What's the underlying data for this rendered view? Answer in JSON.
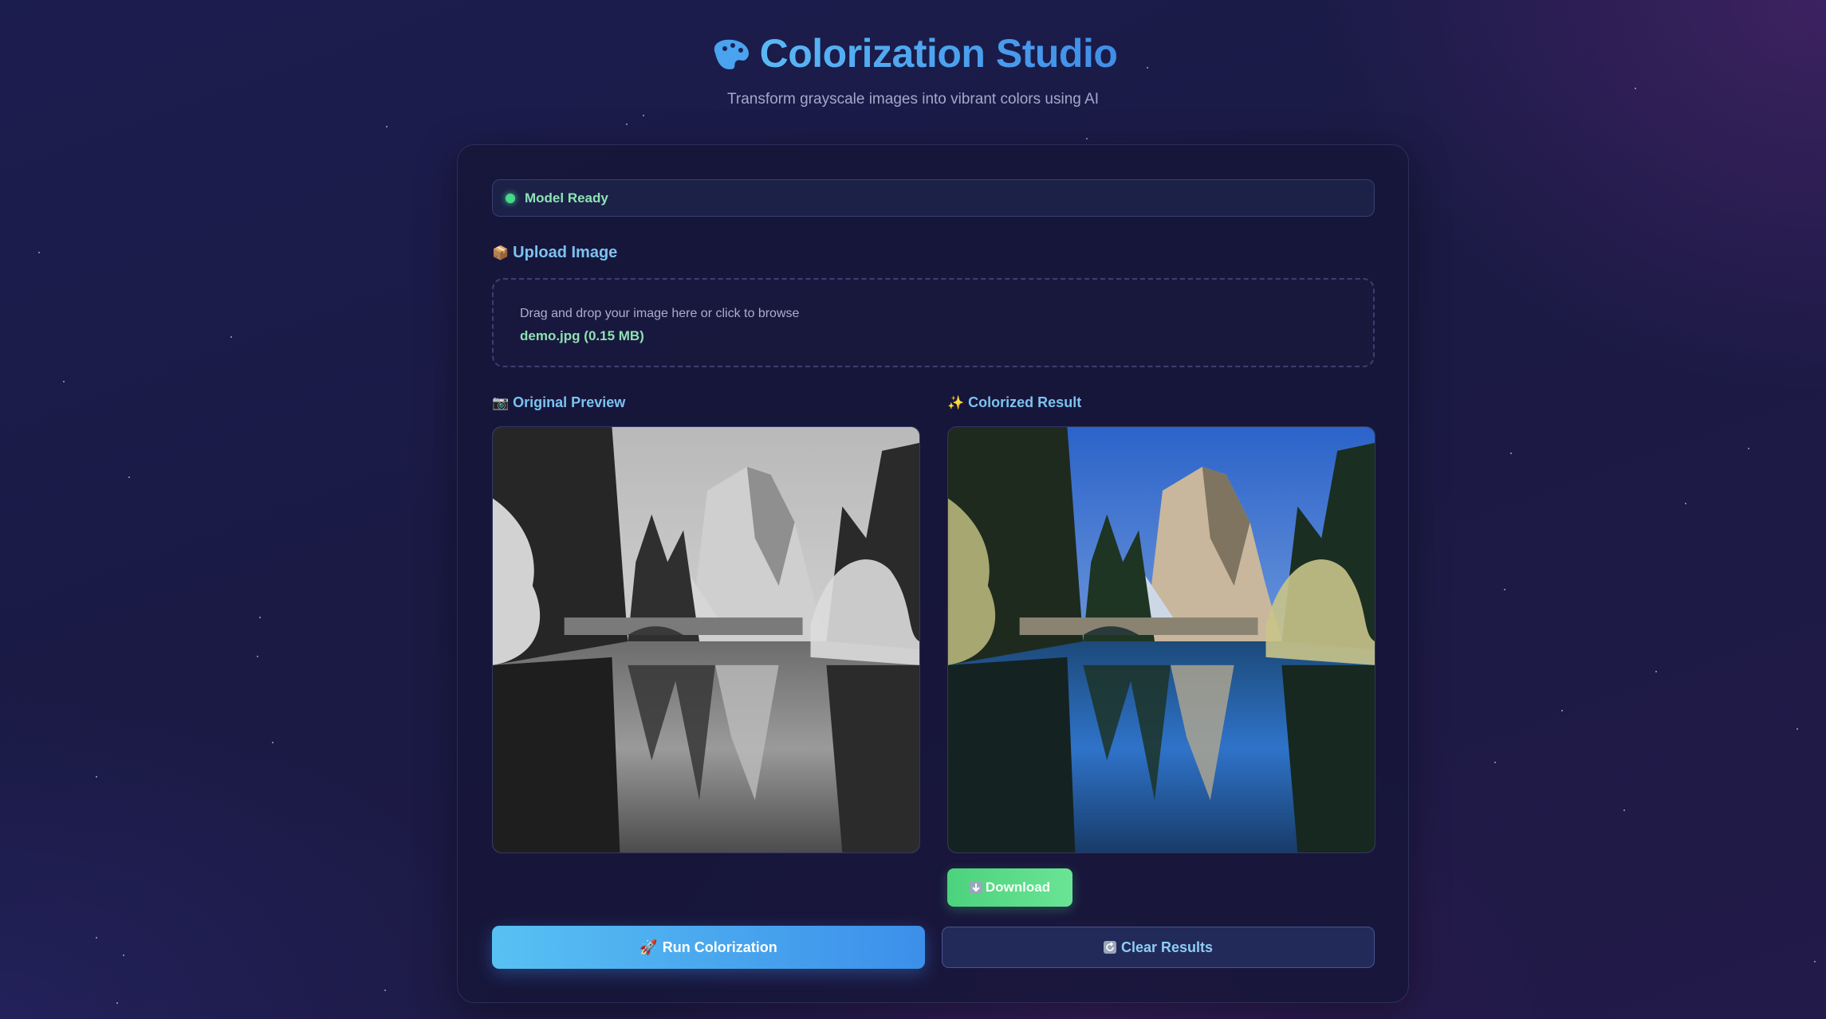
{
  "header": {
    "title": "Colorization Studio",
    "subtitle": "Transform grayscale images into vibrant colors using AI",
    "logo_icon": "palette-icon"
  },
  "status": {
    "text": "Model Ready",
    "state": "ready",
    "color": "#46d98a"
  },
  "upload": {
    "label": "Upload Image",
    "label_icon": "package-icon",
    "hint": "Drag and drop your image here or click to browse",
    "file": "demo.jpg (0.15 MB)"
  },
  "preview": {
    "original_label": "Original Preview",
    "original_icon": "camera-icon",
    "result_label": "Colorized Result",
    "result_icon": "sparkles-icon"
  },
  "actions": {
    "download_label": "Download",
    "download_icon": "download-arrow-icon",
    "run_label": "Run Colorization",
    "run_icon": "rocket-icon",
    "clear_label": "Clear Results",
    "clear_icon": "refresh-icon"
  },
  "colors": {
    "accent_blue": "#3f8ee8",
    "accent_green": "#4cd27c",
    "background": "#1c1d4f"
  }
}
